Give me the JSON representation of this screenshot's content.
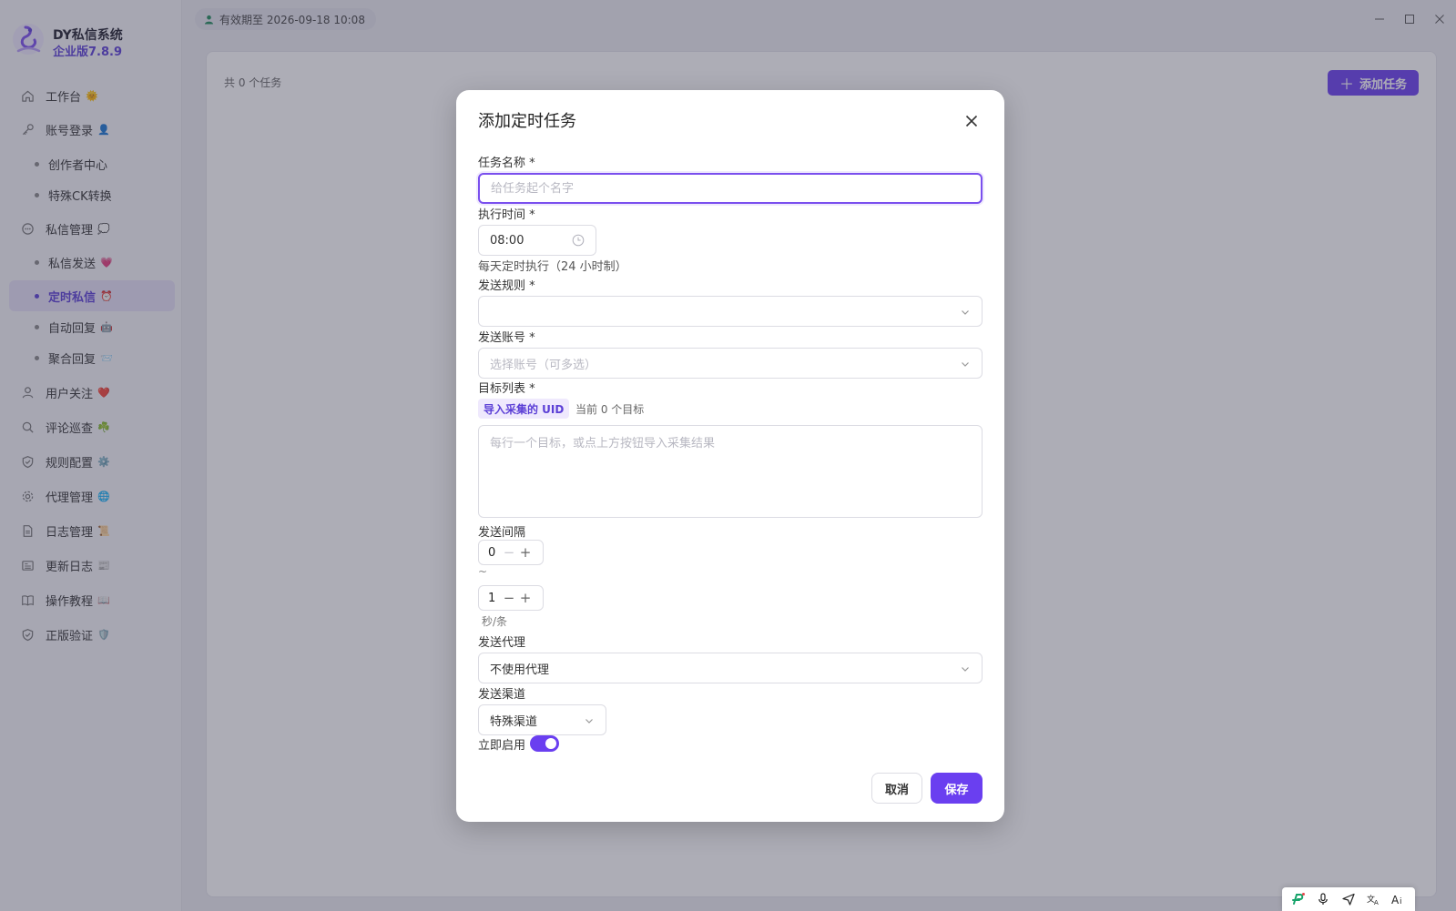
{
  "app": {
    "name": "DY私信系统",
    "version": "企业版7.8.9",
    "validity": "有效期至 2026-09-18 10:08"
  },
  "sidebar": {
    "items": [
      {
        "label": "工作台",
        "emoji": "🌞",
        "type": "main",
        "icon": "home-icon"
      },
      {
        "label": "账号登录",
        "emoji": "👤",
        "type": "main",
        "icon": "key-icon"
      },
      {
        "label": "创作者中心",
        "emoji": "",
        "type": "sub"
      },
      {
        "label": "特殊CK转换",
        "emoji": "",
        "type": "sub"
      },
      {
        "label": "私信管理",
        "emoji": "💭",
        "type": "main",
        "icon": "chat-icon"
      },
      {
        "label": "私信发送",
        "emoji": "💗",
        "type": "sub"
      },
      {
        "label": "定时私信",
        "emoji": "⏰",
        "type": "sub",
        "active": true
      },
      {
        "label": "自动回复",
        "emoji": "🤖",
        "type": "sub"
      },
      {
        "label": "聚合回复",
        "emoji": "📨",
        "type": "sub"
      },
      {
        "label": "用户关注",
        "emoji": "❤️",
        "type": "main",
        "icon": "user-icon"
      },
      {
        "label": "评论巡查",
        "emoji": "☘️",
        "type": "main",
        "icon": "search-icon"
      },
      {
        "label": "规则配置",
        "emoji": "⚙️",
        "type": "main",
        "icon": "shield-icon"
      },
      {
        "label": "代理管理",
        "emoji": "🌐",
        "type": "main",
        "icon": "gear-icon"
      },
      {
        "label": "日志管理",
        "emoji": "📜",
        "type": "main",
        "icon": "document-icon"
      },
      {
        "label": "更新日志",
        "emoji": "📰",
        "type": "main",
        "icon": "news-icon"
      },
      {
        "label": "操作教程",
        "emoji": "📖",
        "type": "main",
        "icon": "book-icon"
      },
      {
        "label": "正版验证",
        "emoji": "🛡️",
        "type": "main",
        "icon": "shield-check-icon"
      }
    ]
  },
  "main": {
    "task_count": "共 0 个任务",
    "add_task_label": "添加任务"
  },
  "dialog": {
    "title": "添加定时任务",
    "task_name_label": "任务名称 *",
    "task_name_placeholder": "给任务起个名字",
    "exec_time_label": "执行时间 *",
    "exec_time_value": "08:00",
    "exec_time_hint": "每天定时执行（24 小时制）",
    "send_rule_label": "发送规则 *",
    "send_rule_value": "",
    "send_account_label": "发送账号 *",
    "send_account_placeholder": "选择账号（可多选）",
    "target_list_label": "目标列表 *",
    "import_uid_label": "导入采集的 UID",
    "target_count": "当前 0 个目标",
    "target_placeholder": "每行一个目标，或点上方按钮导入采集结果",
    "interval_label": "发送间隔",
    "interval_min": "0",
    "interval_sep": "~",
    "interval_max": "1",
    "interval_unit": "秒/条",
    "proxy_label": "发送代理",
    "proxy_value": "不使用代理",
    "channel_label": "发送渠道",
    "channel_value": "特殊渠道",
    "enable_label": "立即启用",
    "enable_on": true,
    "cancel_label": "取消",
    "save_label": "保存"
  },
  "colors": {
    "accent": "#6a3ff0",
    "accent_text": "#5b3fd6"
  }
}
